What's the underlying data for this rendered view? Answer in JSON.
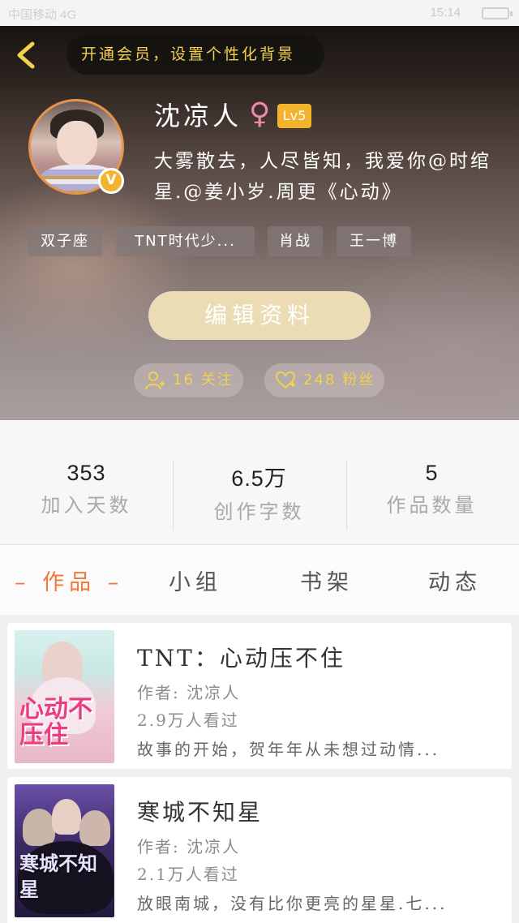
{
  "status_bar": {
    "left_text": "中国移动 4G",
    "time": "15:14"
  },
  "banner": {
    "vip_text": "开通会员，设置个性化背景"
  },
  "profile": {
    "username": "沈凉人",
    "gender_symbol": "♀",
    "level": "Lv5",
    "verified_badge": "V",
    "bio": "大雾散去，人尽皆知，我爱你@时绾星.@姜小岁.周更《心动》",
    "tags": [
      "双子座",
      "TNT时代少...",
      "肖战",
      "王一博"
    ],
    "edit_button": "编辑资料",
    "following_label": "16 关注",
    "fans_label": "248 粉丝"
  },
  "stats": [
    {
      "value": "353",
      "label": "加入天数"
    },
    {
      "value": "6.5万",
      "label": "创作字数"
    },
    {
      "value": "5",
      "label": "作品数量"
    }
  ],
  "tabs": [
    {
      "label": "– 作品 –",
      "active": true
    },
    {
      "label": "小组",
      "active": false
    },
    {
      "label": "书架",
      "active": false
    },
    {
      "label": "动态",
      "active": false
    }
  ],
  "works": [
    {
      "title": "TNT：心动压不住",
      "author": "作者: 沈凉人",
      "views": "2.9万人看过",
      "desc": "故事的开始，贺年年从未想过动情...",
      "cover_text": "心动不压住"
    },
    {
      "title": "寒城不知星",
      "author": "作者: 沈凉人",
      "views": "2.1万人看过",
      "desc": "放眼南城，没有比你更亮的星星.七...",
      "cover_text": "寒城不知星"
    }
  ],
  "colors": {
    "accent": "#f3773a",
    "gold": "#f1d14e",
    "level_badge": "#f4b32c",
    "edit_button": "#ecdcb6"
  }
}
